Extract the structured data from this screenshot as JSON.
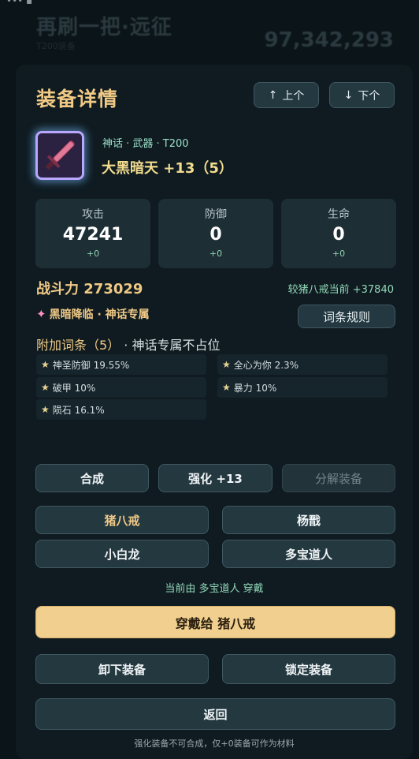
{
  "background": {
    "title": "再刷一把·远征",
    "subtitle": "T200装备",
    "number": "97,342,293"
  },
  "modal": {
    "title": "装备详情",
    "prev_label": "上个",
    "next_label": "下个",
    "item": {
      "meta": "神话 · 武器 · T200",
      "name": "大黑暗天 +13（5）"
    },
    "stats": [
      {
        "label": "攻击",
        "value": "47241",
        "delta": "+0"
      },
      {
        "label": "防御",
        "value": "0",
        "delta": "+0"
      },
      {
        "label": "生命",
        "value": "0",
        "delta": "+0"
      }
    ],
    "power": "战斗力 273029",
    "compare": "较猪八戒当前 +37840",
    "set_tag": "黑暗降临 · 神话专属",
    "rules_button": "词条规则",
    "affix_title": "附加词条（5）",
    "affix_subtitle": " · 神话专属不占位",
    "affixes": [
      "神圣防御 19.55%",
      "全心为你 2.3%",
      "破甲 10%",
      "暴力 10%",
      "陨石 16.1%"
    ],
    "actions": {
      "compose": "合成",
      "enhance": "强化 +13",
      "decompose": "分解装备"
    },
    "heroes": [
      "猪八戒",
      "杨戬",
      "小白龙",
      "多宝道人"
    ],
    "current_owner": "当前由 多宝道人 穿戴",
    "equip_button": "穿戴给 猪八戒",
    "unequip_button": "卸下装备",
    "lock_button": "锁定装备",
    "back_button": "返回",
    "footnote": "强化装备不可合成，仅+0装备可作为材料"
  }
}
